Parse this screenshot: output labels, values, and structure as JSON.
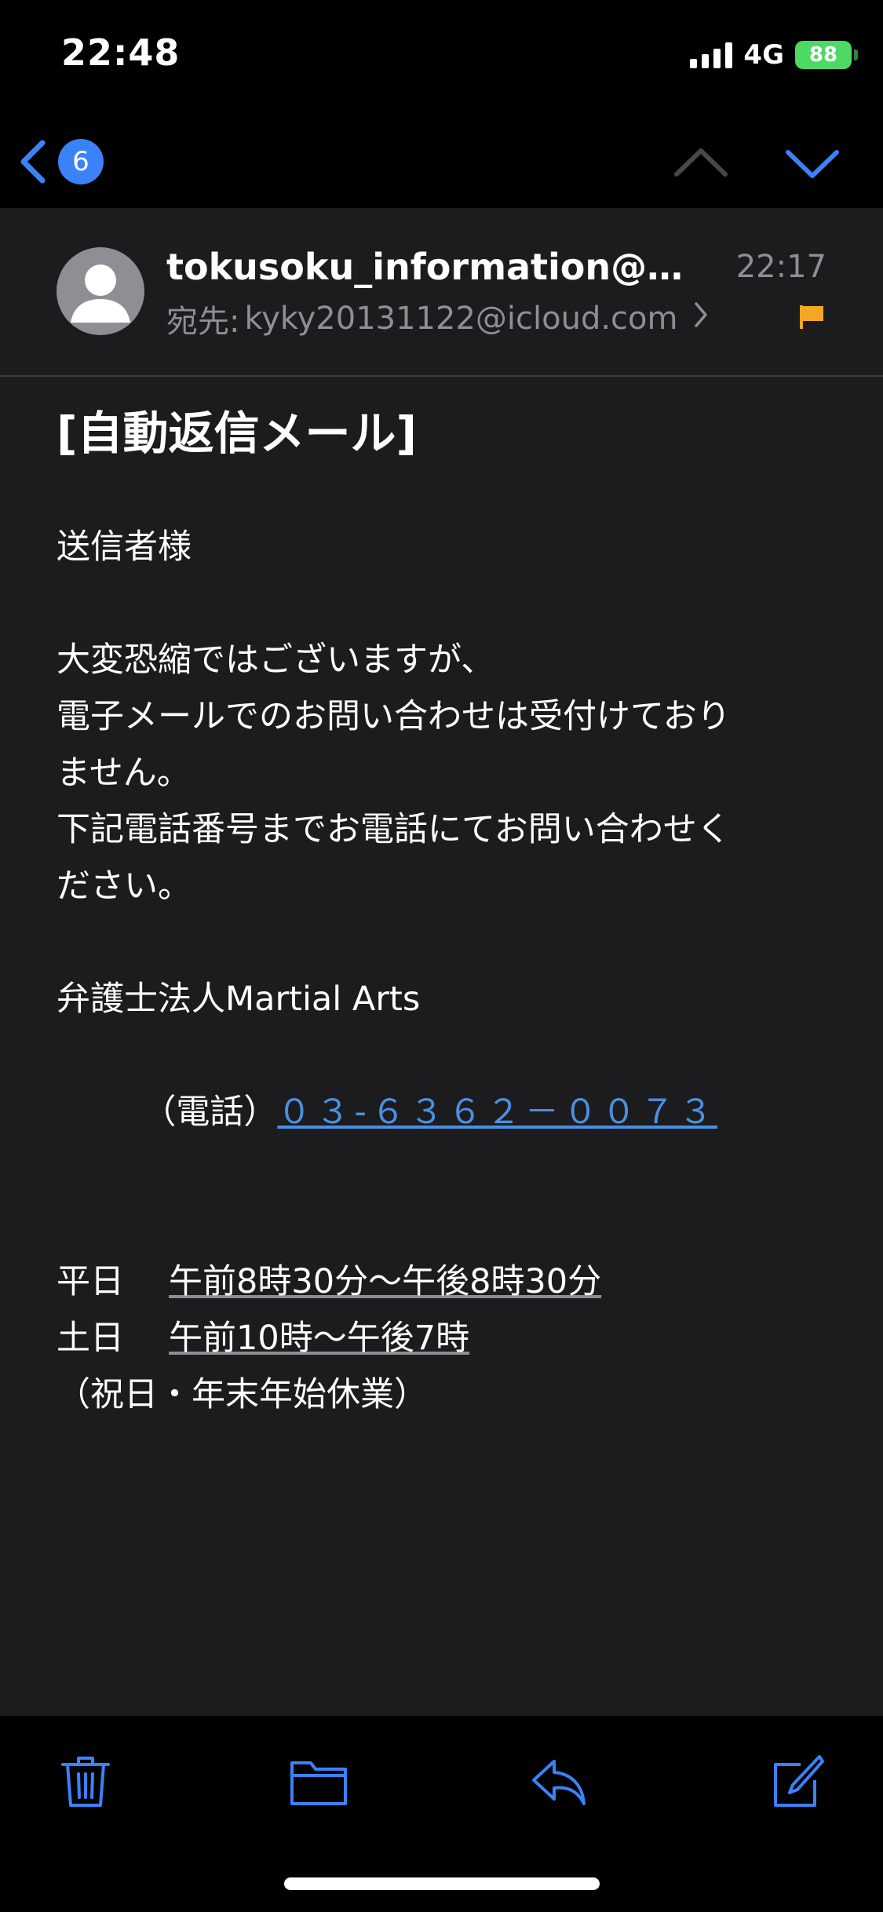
{
  "status_bar": {
    "time": "22:48",
    "network": "4G",
    "battery": "88"
  },
  "nav": {
    "unread_count": "6"
  },
  "header": {
    "sender": "tokusoku_information@ma...",
    "time": "22:17",
    "recipient_label": "宛先:",
    "recipient": "kyky20131122@icloud.com"
  },
  "body": {
    "subject": "[自動返信メール]",
    "greeting": "送信者様",
    "para1_line1": "大変恐縮ではございますが、",
    "para1_line2": "電子メールでのお問い合わせは受付けており",
    "para1_line3": "ません。",
    "para1_line4": "下記電話番号までお電話にてお問い合わせく",
    "para1_line5": "ださい。",
    "firm": "弁護士法人Martial Arts",
    "phone_prefix": "（電話）",
    "phone": "０３-６３６２－００７３",
    "hours": [
      {
        "label": "平日",
        "value": "午前8時30分〜午後8時30分"
      },
      {
        "label": "土日",
        "value": "午前10時〜午後7時"
      }
    ],
    "holidays": "（祝日・年末年始休業）"
  },
  "colors": {
    "accent": "#3a82f7",
    "link": "#4a90e2",
    "flag": "#f5a623",
    "background": "#1c1c1e"
  },
  "icons": [
    "back-chevron-icon",
    "chevron-up-icon",
    "chevron-down-icon",
    "flag-icon",
    "trash-icon",
    "folder-icon",
    "reply-icon",
    "compose-icon"
  ]
}
